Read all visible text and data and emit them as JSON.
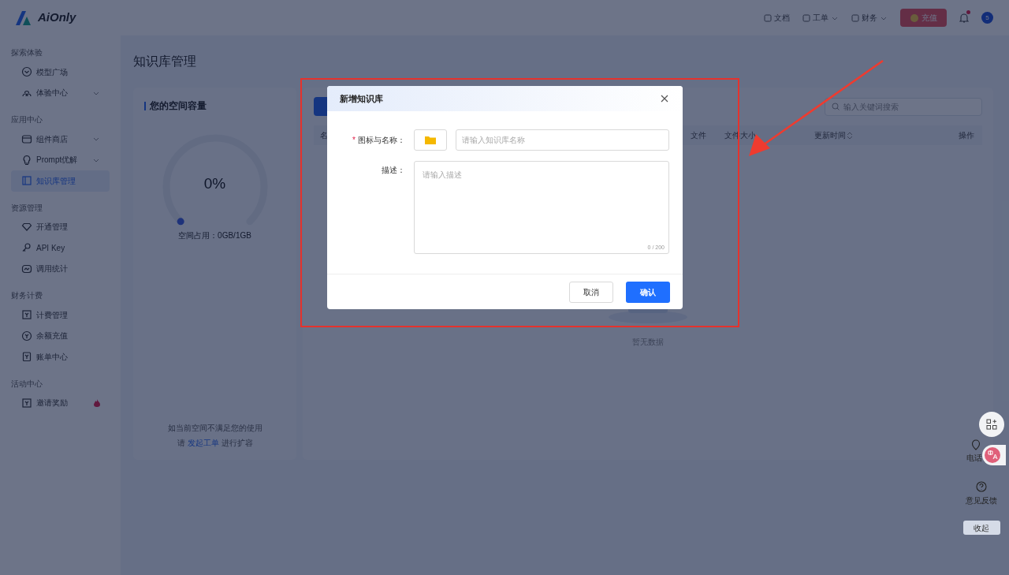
{
  "header": {
    "logo": "AiOnly",
    "nav": [
      {
        "label": "文档",
        "dropdown": false
      },
      {
        "label": "工单",
        "dropdown": true
      },
      {
        "label": "财务",
        "dropdown": true
      }
    ],
    "recharge": "充值",
    "avatar": "5"
  },
  "sidebar": {
    "sections": [
      {
        "title": "探索体验",
        "items": [
          {
            "label": "模型广场",
            "expandable": false,
            "selected": false,
            "hot": false
          },
          {
            "label": "体验中心",
            "expandable": true,
            "selected": false,
            "hot": false
          }
        ]
      },
      {
        "title": "应用中心",
        "items": [
          {
            "label": "组件商店",
            "expandable": true,
            "selected": false,
            "hot": false
          },
          {
            "label": "Prompt优解",
            "expandable": true,
            "selected": false,
            "hot": false
          },
          {
            "label": "知识库管理",
            "expandable": false,
            "selected": true,
            "hot": false
          }
        ]
      },
      {
        "title": "资源管理",
        "items": [
          {
            "label": "开通管理",
            "expandable": false,
            "selected": false,
            "hot": false
          },
          {
            "label": "API Key",
            "expandable": false,
            "selected": false,
            "hot": false
          },
          {
            "label": "调用统计",
            "expandable": false,
            "selected": false,
            "hot": false
          }
        ]
      },
      {
        "title": "财务计费",
        "items": [
          {
            "label": "计费管理",
            "expandable": false,
            "selected": false,
            "hot": false
          },
          {
            "label": "余额充值",
            "expandable": false,
            "selected": false,
            "hot": false
          },
          {
            "label": "账单中心",
            "expandable": false,
            "selected": false,
            "hot": false
          }
        ]
      },
      {
        "title": "活动中心",
        "items": [
          {
            "label": "邀请奖励",
            "expandable": false,
            "selected": false,
            "hot": true
          }
        ]
      }
    ]
  },
  "page_title": "知识库管理",
  "capacity": {
    "title": "您的空间容量",
    "percent": "0%",
    "usage_label": "空间占用：",
    "usage": "0GB/1GB",
    "note": "如当前空间不满足您的使用",
    "note_prefix": "请",
    "note_link": "发起工单",
    "note_suffix": "进行扩容"
  },
  "table": {
    "search_placeholder": "输入关键词搜索",
    "columns": [
      {
        "label": "名",
        "sortable": false
      },
      {
        "label": "文件",
        "sortable": false
      },
      {
        "label": "文件大小",
        "sortable": false
      },
      {
        "label": "更新时间",
        "sortable": true
      },
      {
        "label": "操作",
        "sortable": false
      }
    ],
    "empty": "暂无数据"
  },
  "modal": {
    "title": "新增知识库",
    "name_label": "图标与名称：",
    "required_mark": "*",
    "name_placeholder": "请输入知识库名称",
    "desc_label": "描述：",
    "desc_placeholder": "请输入描述",
    "counter": "0 / 200",
    "cancel": "取消",
    "confirm": "确认"
  },
  "float_panel": {
    "items": [
      "电话",
      "意见反馈"
    ],
    "collapse": "收起"
  }
}
